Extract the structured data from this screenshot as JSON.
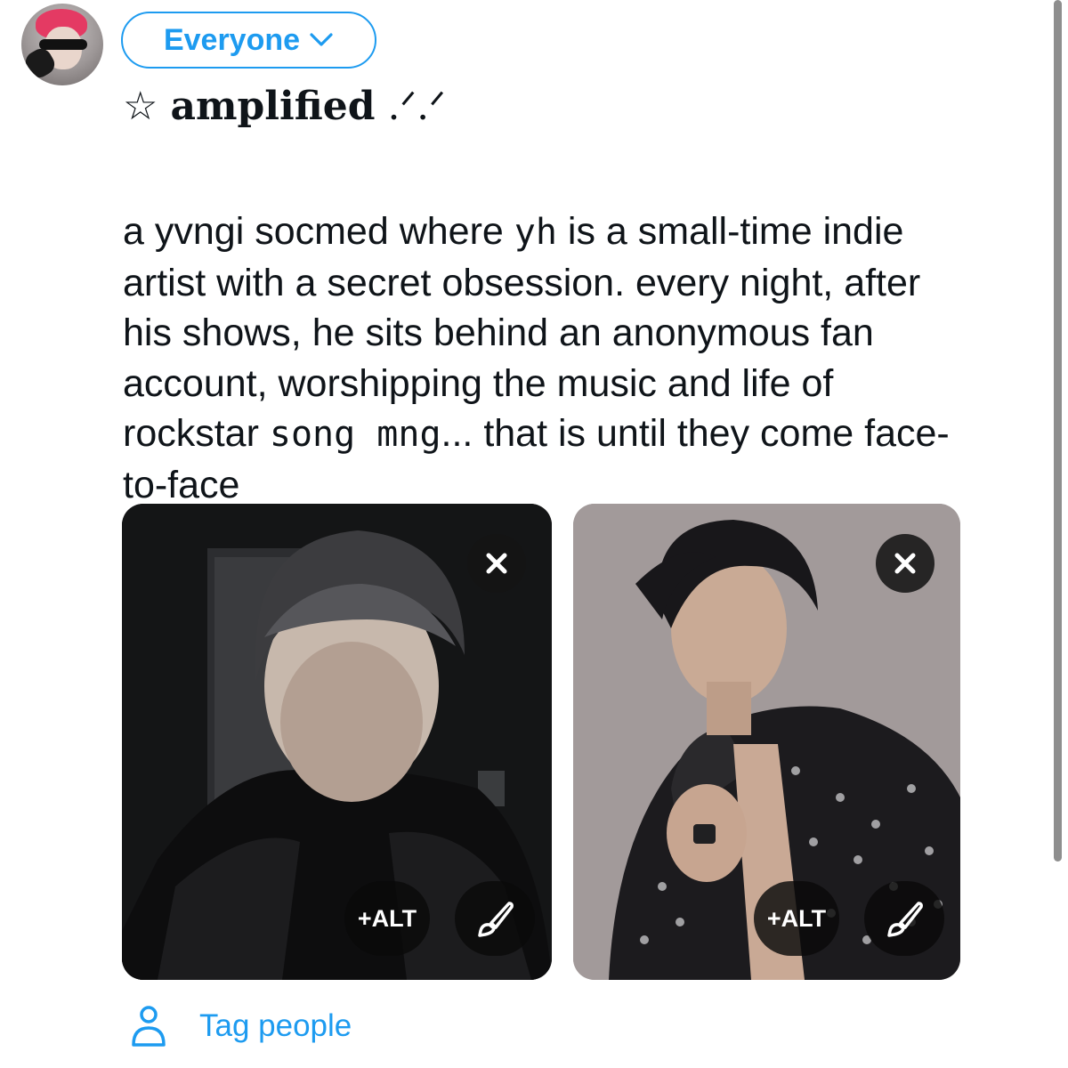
{
  "composer": {
    "audience_label": "Everyone",
    "accent_color": "#1d9bf0"
  },
  "post": {
    "title_star": "☆",
    "title_word": "amplified",
    "title_decoration": ".ᐟ.ᐟ",
    "line1_a": "a yvngi socmed where ",
    "line1_mono": "yh",
    "line1_b": " is a small-time indie",
    "line2": "artist with a secret obsession. every night, after",
    "line3": "his shows, he sits behind an anonymous fan",
    "line4": "account, worshipping the music and life of",
    "line5_a": "rockstar ",
    "line5_mono": "song mng",
    "line5_b": "... that is until they come face-",
    "line6": "to-face"
  },
  "media": [
    {
      "alt_label": "+ALT",
      "remove_icon": "close-icon",
      "edit_icon": "brush-icon"
    },
    {
      "alt_label": "+ALT",
      "remove_icon": "close-icon",
      "edit_icon": "brush-icon"
    }
  ],
  "footer": {
    "tag_people_label": "Tag people"
  }
}
